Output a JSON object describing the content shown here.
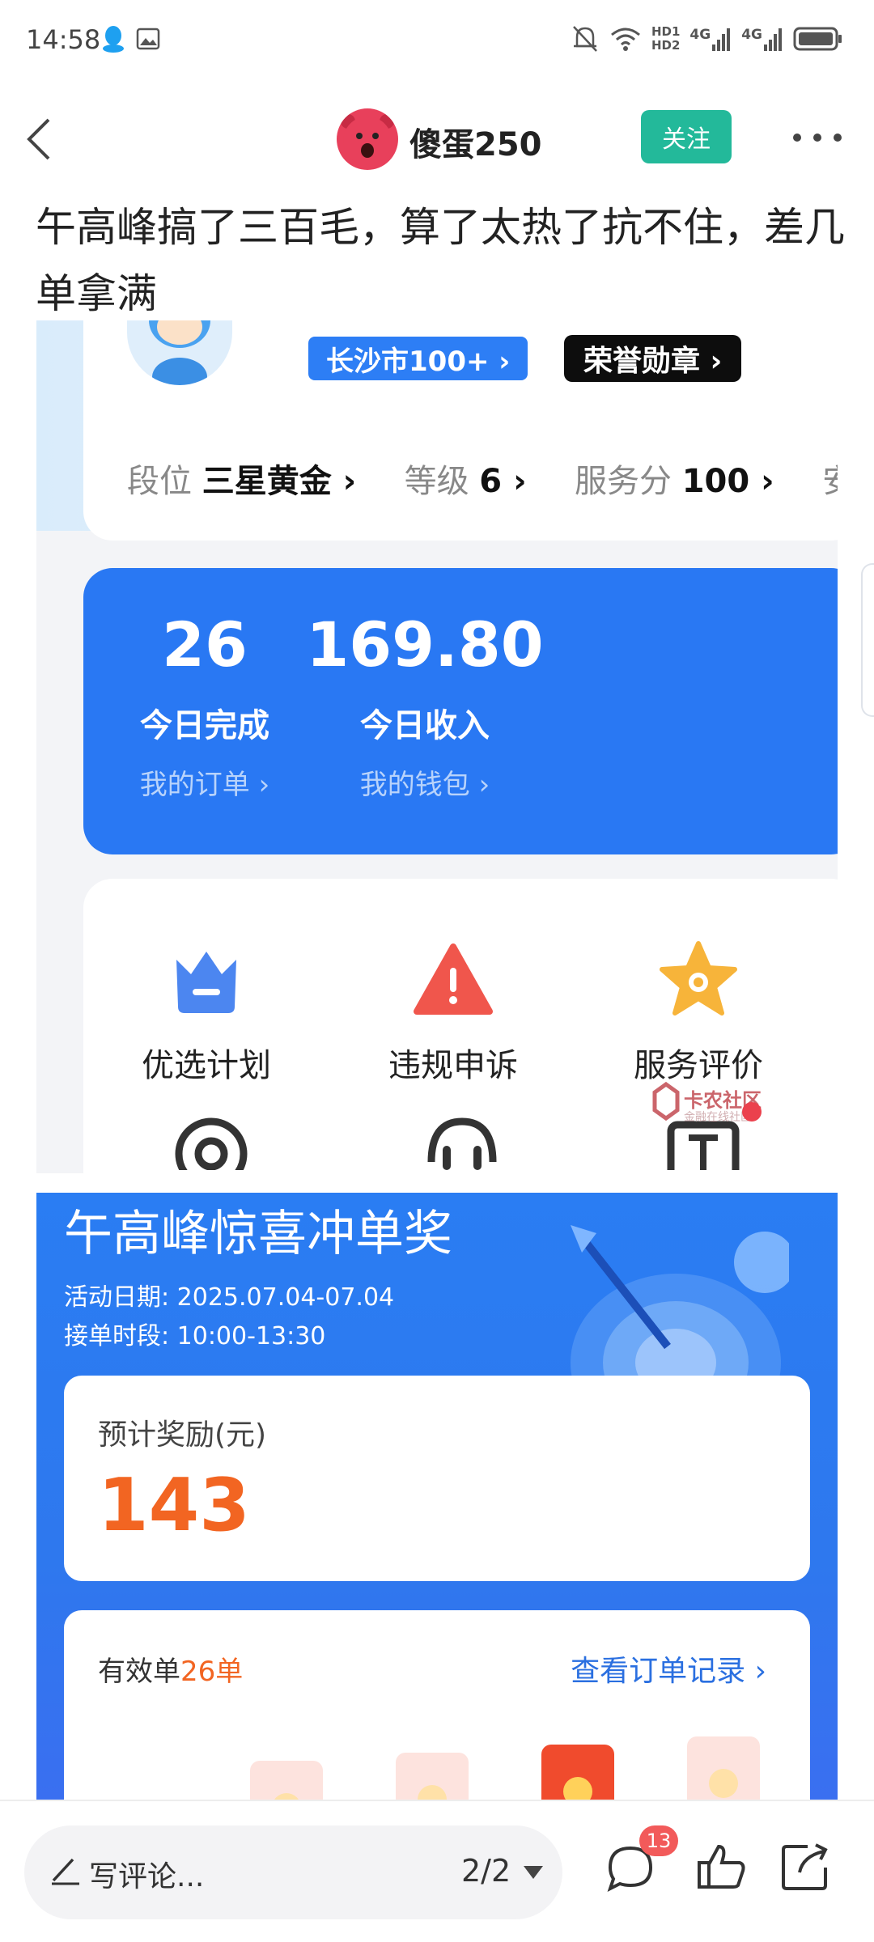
{
  "status_bar": {
    "time": "14:58",
    "hd1": "HD1",
    "hd2": "HD2",
    "net1": "4G",
    "net2": "4G",
    "icons": [
      "qq-icon",
      "gallery-icon",
      "mute-bell-icon",
      "wifi-icon",
      "signal-icon",
      "battery-icon"
    ]
  },
  "nav": {
    "username": "傻蛋250",
    "follow_label": "关注"
  },
  "post": {
    "title": "午高峰搞了三百毛，算了太热了抗不住，差几单拿满"
  },
  "shot1": {
    "city_tag": "长沙市100+ ›",
    "honor_tag": "荣誉勋章 ›",
    "stats": [
      {
        "label": "段位",
        "value": "三星黄金"
      },
      {
        "label": "等级",
        "value": "6"
      },
      {
        "label": "服务分",
        "value": "100"
      },
      {
        "label": "安全",
        "value": ""
      }
    ],
    "completed_value": "26",
    "completed_label": "今日完成",
    "orders_link": "我的订单 ›",
    "income_value": "169.80",
    "income_label": "今日收入",
    "wallet_link": "我的钱包 ›",
    "menu": [
      {
        "label": "优选计划",
        "icon": "crown-icon",
        "color": "#4c86f0"
      },
      {
        "label": "违规申诉",
        "icon": "warning-icon",
        "color": "#f0564c"
      },
      {
        "label": "服务评价",
        "icon": "star-icon",
        "color": "#f7b43a"
      }
    ],
    "watermark": "卡农社区",
    "watermark_sub": "金融在线社区"
  },
  "shot2": {
    "title": "午高峰惊喜冲单奖",
    "date": "活动日期: 2025.07.04-07.04",
    "time": "接单时段: 10:00-13:30",
    "reward_label": "预计奖励(元)",
    "reward_amount": "143",
    "valid_prefix": "有效单",
    "valid_count": "26单",
    "records_link": "查看订单记录 ›"
  },
  "bottom": {
    "comment_placeholder": "写评论...",
    "page_indicator": "2/2",
    "comment_count": "13"
  },
  "colors": {
    "accent_green": "#23b99a",
    "app_blue": "#2978f3",
    "reward_orange": "#f26522"
  }
}
